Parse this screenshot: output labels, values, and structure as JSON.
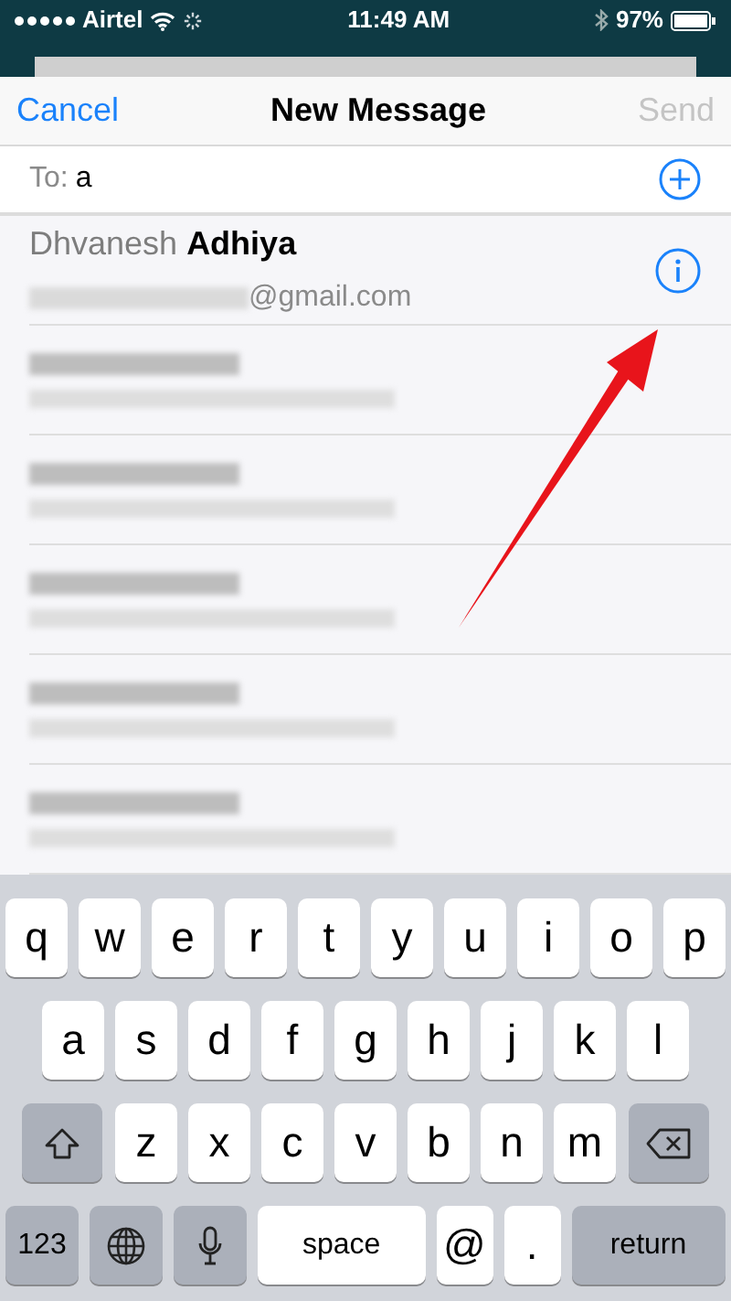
{
  "status_bar": {
    "carrier": "Airtel",
    "time": "11:49 AM",
    "battery": "97%"
  },
  "nav": {
    "cancel": "Cancel",
    "title": "New Message",
    "send": "Send",
    "send_disabled": true
  },
  "to_field": {
    "label": "To:",
    "value": "a"
  },
  "contacts": [
    {
      "kind": "shown",
      "name": "Dhvanesh **Adhiya**",
      "email": "@gmail.com"
    },
    {
      "kind": "blurred"
    },
    {
      "kind": "blurred"
    },
    {
      "kind": "blurred"
    },
    {
      "kind": "blurred"
    },
    {
      "kind": "blurred"
    }
  ],
  "keyboard": [
    [
      {
        "kind": "letter",
        "label": "q"
      },
      {
        "kind": "letter",
        "label": "w"
      },
      {
        "kind": "letter",
        "label": "e"
      },
      {
        "kind": "letter",
        "label": "r"
      },
      {
        "kind": "letter",
        "label": "t"
      },
      {
        "kind": "letter",
        "label": "y"
      },
      {
        "kind": "letter",
        "label": "u"
      },
      {
        "kind": "letter",
        "label": "i"
      },
      {
        "kind": "letter",
        "label": "o"
      },
      {
        "kind": "letter",
        "label": "p"
      }
    ],
    [
      {
        "kind": "letter",
        "label": "a"
      },
      {
        "kind": "letter",
        "label": "s"
      },
      {
        "kind": "letter",
        "label": "d"
      },
      {
        "kind": "letter",
        "label": "f"
      },
      {
        "kind": "letter",
        "label": "g"
      },
      {
        "kind": "letter",
        "label": "h"
      },
      {
        "kind": "letter",
        "label": "j"
      },
      {
        "kind": "letter",
        "label": "k"
      },
      {
        "kind": "letter",
        "label": "l"
      }
    ],
    [
      {
        "kind": "shift"
      },
      {
        "kind": "letter",
        "label": "z"
      },
      {
        "kind": "letter",
        "label": "x"
      },
      {
        "kind": "letter",
        "label": "c"
      },
      {
        "kind": "letter",
        "label": "v"
      },
      {
        "kind": "letter",
        "label": "b"
      },
      {
        "kind": "letter",
        "label": "n"
      },
      {
        "kind": "letter",
        "label": "m"
      },
      {
        "kind": "delete"
      }
    ],
    [
      {
        "kind": "function",
        "label": "123"
      },
      {
        "kind": "globe"
      },
      {
        "kind": "mic"
      },
      {
        "kind": "space",
        "label": "space"
      },
      {
        "kind": "letter",
        "label": "@"
      },
      {
        "kind": "letter",
        "label": "."
      },
      {
        "kind": "return",
        "label": "return"
      }
    ]
  ]
}
